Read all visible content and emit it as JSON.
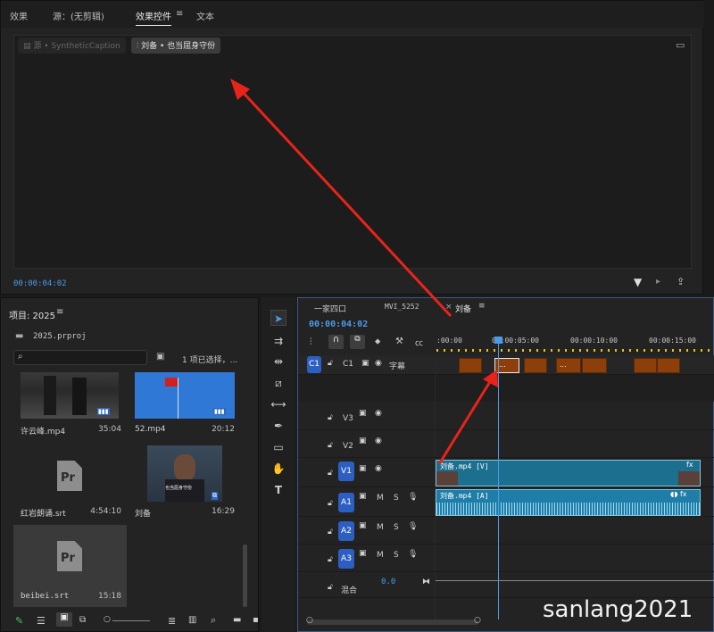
{
  "top_panel": {
    "tabs": [
      "效果",
      "源：(无剪辑)",
      "效果控件",
      "文本"
    ],
    "active_tab": "效果控件",
    "source_crumb": "源 • SyntheticCaption",
    "clip_crumb": "刘备 • 也当屈身守份",
    "timecode": "00:00:04:02"
  },
  "project": {
    "title": "项目: 2025",
    "file": "2025.prproj",
    "selection": "1 项已选择，...",
    "items": [
      {
        "name": "许云峰.mp4",
        "duration": "35:04"
      },
      {
        "name": "52.mp4",
        "duration": "20:12"
      },
      {
        "name": "红岩朗诵.srt",
        "duration": "4:54:10"
      },
      {
        "name": "刘备",
        "duration": "16:29"
      },
      {
        "name": "beibei.srt",
        "duration": "15:18"
      }
    ],
    "thumb_caption": "也当屈身守份"
  },
  "timeline": {
    "tabs": [
      "一家四口",
      "MVI_5252",
      "刘备"
    ],
    "active_tab": "刘备",
    "timecode": "00:00:04:02",
    "ruler": [
      ":00:00",
      "00:00:05:00",
      "00:00:10:00",
      "00:00:15:00"
    ],
    "tracks": {
      "c1": {
        "badge": "C1",
        "label": "C1",
        "name": "字幕"
      },
      "v3": "V3",
      "v2": "V2",
      "v1": "V1",
      "a1": "A1",
      "a2": "A2",
      "a3": "A3",
      "mix": "混合",
      "mix_value": "0.0"
    },
    "video_clip": "刘备.mp4 [V]",
    "audio_clip": "刘备.mp4 [A]",
    "caption_dots": "..."
  },
  "watermark": "sanlang2021",
  "colors": {
    "accent": "#2d68c4",
    "caption": "#8c3f0a",
    "video": "#1d6f8f",
    "audio": "#1f7ea8",
    "playhead": "#4c9be8",
    "arrow": "#e8241a"
  }
}
